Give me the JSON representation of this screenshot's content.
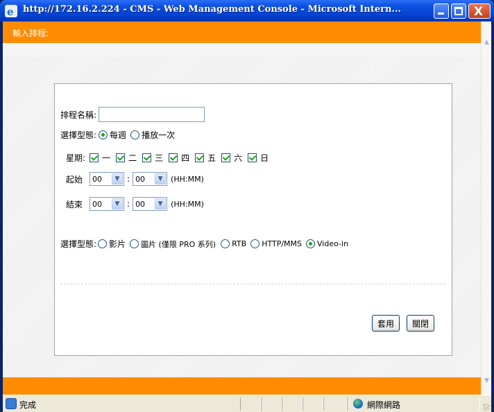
{
  "window": {
    "title": "http://172.16.2.224 - CMS - Web Management Console - Microsoft Intern...",
    "minimize_icon": "minimize-icon",
    "maximize_icon": "maximize-icon",
    "close_icon": "close-icon",
    "close_glyph": "X"
  },
  "header": {
    "title": "輸入排程:"
  },
  "form": {
    "schedule_name_label": "排程名稱:",
    "schedule_name_value": "",
    "type_label": "選擇型態:",
    "type_options": [
      {
        "label": "每週",
        "selected": true
      },
      {
        "label": "播放一次",
        "selected": false
      }
    ],
    "weekday_label": "星期:",
    "weekdays": [
      {
        "label": "一",
        "checked": true
      },
      {
        "label": "二",
        "checked": true
      },
      {
        "label": "三",
        "checked": true
      },
      {
        "label": "四",
        "checked": true
      },
      {
        "label": "五",
        "checked": true
      },
      {
        "label": "六",
        "checked": true
      },
      {
        "label": "日",
        "checked": true
      }
    ],
    "start_label": "起始",
    "start_hour": "00",
    "start_minute": "00",
    "end_label": "結束",
    "end_hour": "00",
    "end_minute": "00",
    "time_sep": ":",
    "time_format": "(HH:MM)",
    "source_label": "選擇型態:",
    "source_options": [
      {
        "label": "影片",
        "selected": false
      },
      {
        "label": "圖片 (僅限 PRO 系列)",
        "selected": false
      },
      {
        "label": "RTB",
        "selected": false
      },
      {
        "label": "HTTP/MMS",
        "selected": false
      },
      {
        "label": "Video-in",
        "selected": true
      }
    ],
    "apply_label": "套用",
    "close_label": "關閉"
  },
  "statusbar": {
    "status_text": "完成",
    "zone_text": "網際網路"
  },
  "colors": {
    "accent_orange": "#ff8c00",
    "titlebar_blue": "#0542d0",
    "check_green": "#21a121"
  }
}
